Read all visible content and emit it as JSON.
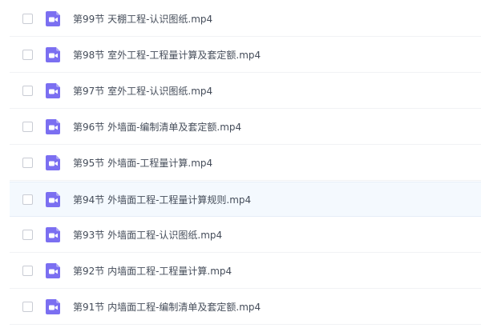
{
  "theme": {
    "icon_color": "#7b6ff1",
    "icon_glyph_color": "#ffffff",
    "text_color": "#454d5a",
    "hover_row_color": "#f4f9fe"
  },
  "files": [
    {
      "name": "第99节 天棚工程-认识图纸.mp4",
      "icon": "video-file-icon",
      "checked": false,
      "highlighted": false
    },
    {
      "name": "第98节 室外工程-工程量计算及套定额.mp4",
      "icon": "video-file-icon",
      "checked": false,
      "highlighted": false
    },
    {
      "name": "第97节 室外工程-认识图纸.mp4",
      "icon": "video-file-icon",
      "checked": false,
      "highlighted": false
    },
    {
      "name": "第96节 外墙面-编制清单及套定额.mp4",
      "icon": "video-file-icon",
      "checked": false,
      "highlighted": false
    },
    {
      "name": "第95节 外墙面-工程量计算.mp4",
      "icon": "video-file-icon",
      "checked": false,
      "highlighted": false
    },
    {
      "name": "第94节 外墙面工程-工程量计算规则.mp4",
      "icon": "video-file-icon",
      "checked": false,
      "highlighted": true
    },
    {
      "name": "第93节 外墙面工程-认识图纸.mp4",
      "icon": "video-file-icon",
      "checked": false,
      "highlighted": false
    },
    {
      "name": "第92节 内墙面工程-工程量计算.mp4",
      "icon": "video-file-icon",
      "checked": false,
      "highlighted": false
    },
    {
      "name": "第91节 内墙面工程-编制清单及套定额.mp4",
      "icon": "video-file-icon",
      "checked": false,
      "highlighted": false
    }
  ]
}
